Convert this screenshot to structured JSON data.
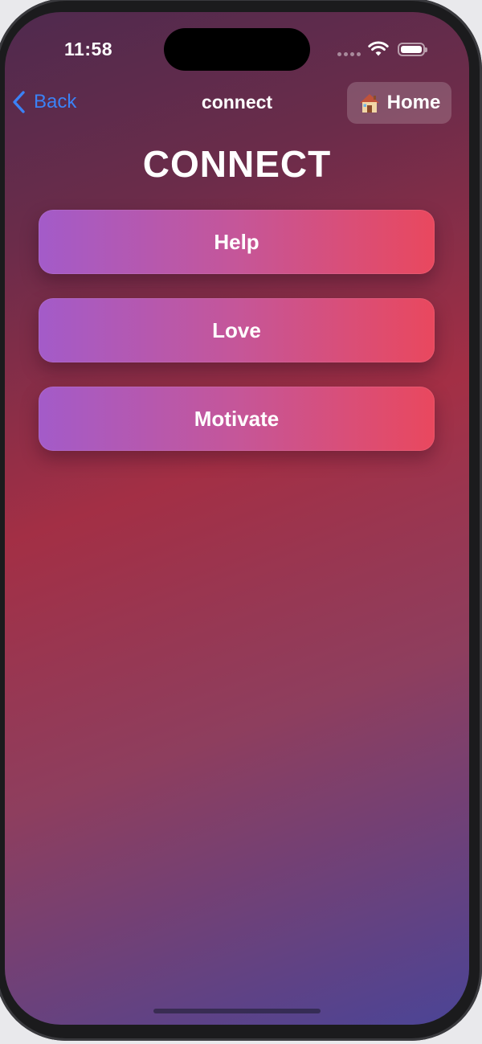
{
  "status_bar": {
    "time": "11:58"
  },
  "nav": {
    "back_label": "Back",
    "title": "connect",
    "home_label": "Home"
  },
  "page": {
    "title": "CONNECT"
  },
  "actions": [
    {
      "label": "Help"
    },
    {
      "label": "Love"
    },
    {
      "label": "Motivate"
    }
  ],
  "colors": {
    "accent": "#3b82f6",
    "button_gradient_start": "#a35bc9",
    "button_gradient_end": "#e9485e",
    "background_top": "#4f2a4e",
    "background_mid": "#a32f45",
    "background_bottom": "#4b4496"
  },
  "icons": {
    "back": "chevron-left-icon",
    "home": "house-icon",
    "wifi": "wifi-icon",
    "battery": "battery-icon"
  }
}
